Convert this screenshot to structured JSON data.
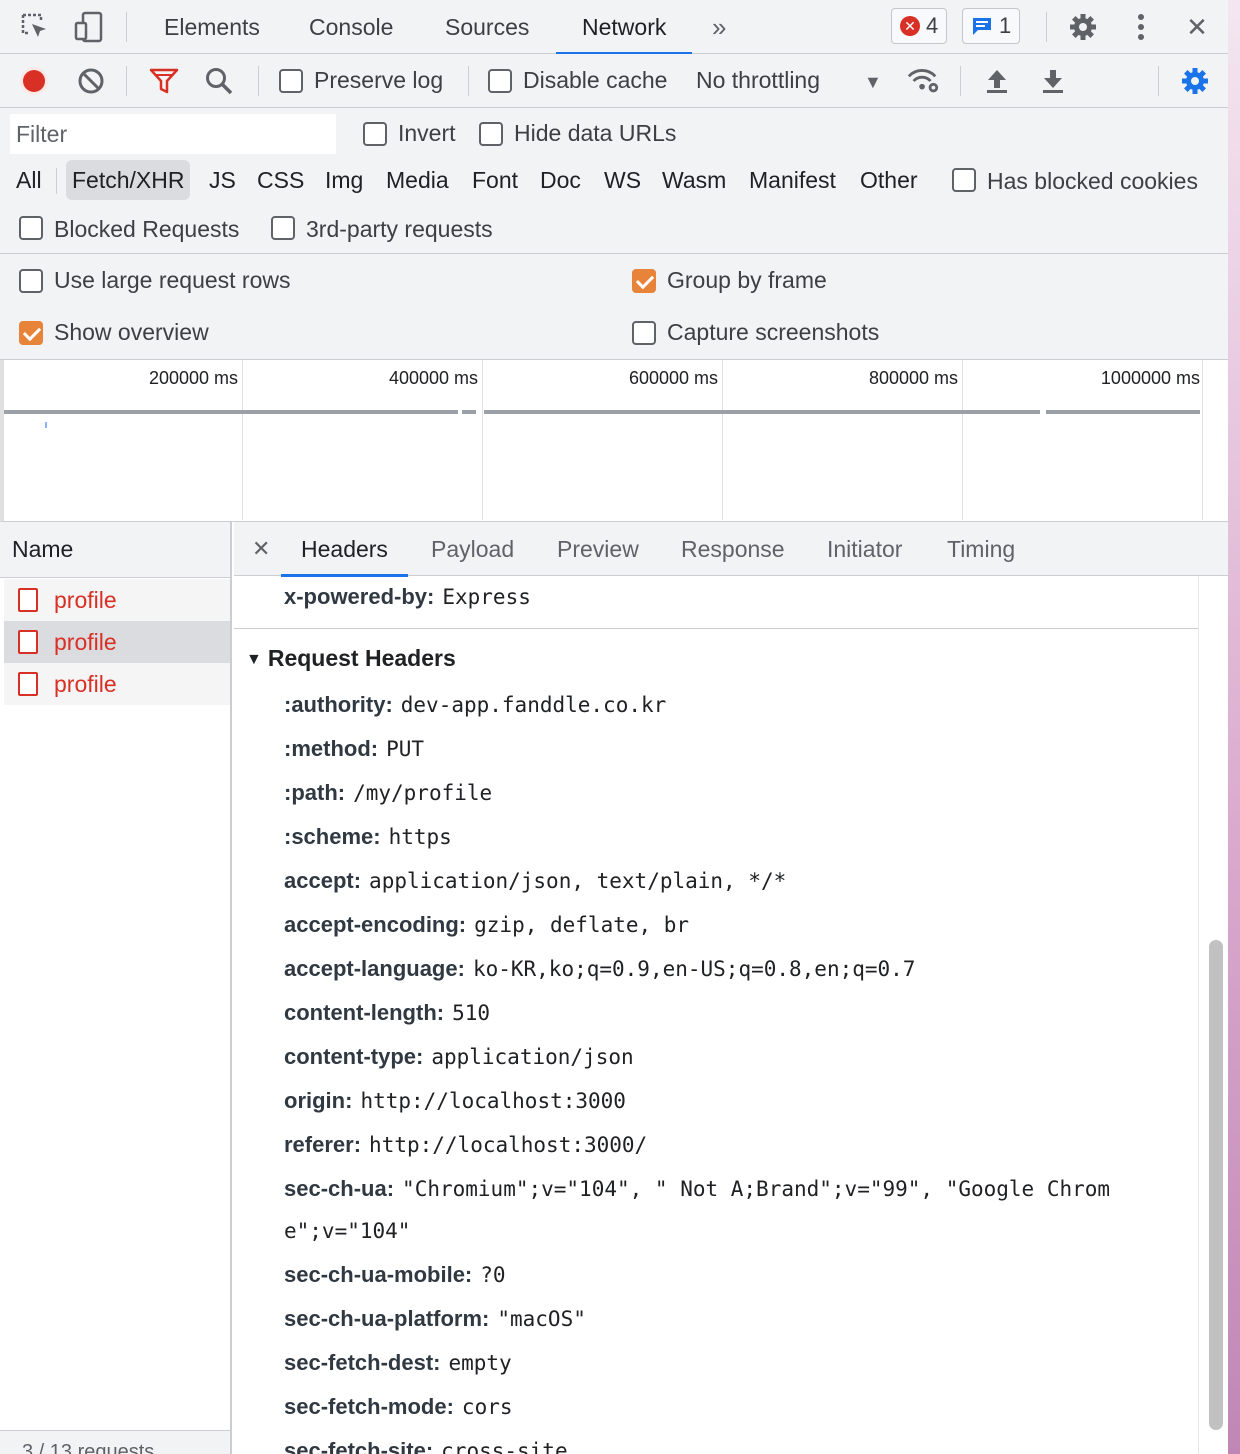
{
  "topbar": {
    "tabs": [
      "Elements",
      "Console",
      "Sources",
      "Network"
    ],
    "active_tab": "Network",
    "more_tabs": "»",
    "errors_count": "4",
    "messages_count": "1",
    "close_label": "✕"
  },
  "toolbar": {
    "preserve_log": {
      "label": "Preserve log",
      "checked": false
    },
    "disable_cache": {
      "label": "Disable cache",
      "checked": false
    },
    "throttling": "No throttling"
  },
  "filter": {
    "placeholder": "Filter",
    "invert": {
      "label": "Invert",
      "checked": false
    },
    "hide_data_urls": {
      "label": "Hide data URLs",
      "checked": false
    },
    "types": [
      "All",
      "Fetch/XHR",
      "JS",
      "CSS",
      "Img",
      "Media",
      "Font",
      "Doc",
      "WS",
      "Wasm",
      "Manifest",
      "Other"
    ],
    "selected_type": "Fetch/XHR",
    "has_blocked_cookies": {
      "label": "Has blocked cookies",
      "checked": false
    },
    "blocked_requests": {
      "label": "Blocked Requests",
      "checked": false
    },
    "third_party": {
      "label": "3rd-party requests",
      "checked": false
    }
  },
  "settings": {
    "large_rows": {
      "label": "Use large request rows",
      "checked": false
    },
    "group_by_frame": {
      "label": "Group by frame",
      "checked": true
    },
    "show_overview": {
      "label": "Show overview",
      "checked": true
    },
    "capture_screenshots": {
      "label": "Capture screenshots",
      "checked": false
    }
  },
  "overview": {
    "ticks": [
      "200000 ms",
      "400000 ms",
      "600000 ms",
      "800000 ms",
      "1000000 ms"
    ]
  },
  "requests": {
    "header": "Name",
    "items": [
      "profile",
      "profile",
      "profile"
    ],
    "selected_index": 1,
    "footer": "3 / 13 requests"
  },
  "details": {
    "close_label": "✕",
    "tabs": [
      "Headers",
      "Payload",
      "Preview",
      "Response",
      "Initiator",
      "Timing"
    ],
    "active_tab": "Headers",
    "response_tail": {
      "key": "x-powered-by:",
      "value": "Express"
    },
    "section_title": "Request Headers",
    "request_headers": [
      {
        "key": ":authority:",
        "value": "dev-app.fanddle.co.kr"
      },
      {
        "key": ":method:",
        "value": "PUT"
      },
      {
        "key": ":path:",
        "value": "/my/profile"
      },
      {
        "key": ":scheme:",
        "value": "https"
      },
      {
        "key": "accept:",
        "value": "application/json, text/plain, */*"
      },
      {
        "key": "accept-encoding:",
        "value": "gzip, deflate, br"
      },
      {
        "key": "accept-language:",
        "value": "ko-KR,ko;q=0.9,en-US;q=0.8,en;q=0.7"
      },
      {
        "key": "content-length:",
        "value": "510"
      },
      {
        "key": "content-type:",
        "value": "application/json"
      },
      {
        "key": "origin:",
        "value": "http://localhost:3000"
      },
      {
        "key": "referer:",
        "value": "http://localhost:3000/"
      },
      {
        "key": "sec-ch-ua:",
        "value": "\"Chromium\";v=\"104\", \" Not A;Brand\";v=\"99\", \"Google Chrom",
        "value_cont": "e\";v=\"104\""
      },
      {
        "key": "sec-ch-ua-mobile:",
        "value": "?0"
      },
      {
        "key": "sec-ch-ua-platform:",
        "value": "\"macOS\""
      },
      {
        "key": "sec-fetch-dest:",
        "value": "empty"
      },
      {
        "key": "sec-fetch-mode:",
        "value": "cors"
      },
      {
        "key": "sec-fetch-site:",
        "value": "cross-site"
      }
    ]
  },
  "colors": {
    "accent": "#1a73e8",
    "error": "#d93025",
    "checkbox_checked": "#e8833a",
    "record": "#d93025"
  }
}
